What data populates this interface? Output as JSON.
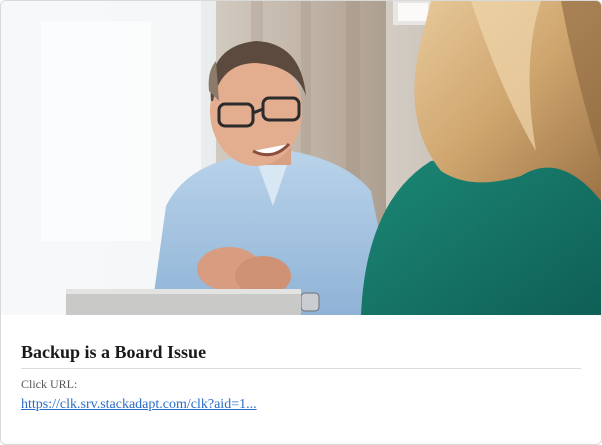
{
  "ad": {
    "image_description_icon": "photo-of-man-smiling-in-meeting",
    "title": "Backup is a Board Issue",
    "click_label": "Click URL:",
    "click_url": "https://clk.srv.stackadapt.com/clk?aid=1..."
  },
  "colors": {
    "title": "#1a1a1a",
    "link": "#2a6cc6",
    "label": "#555555",
    "border": "#d9d9d9"
  }
}
